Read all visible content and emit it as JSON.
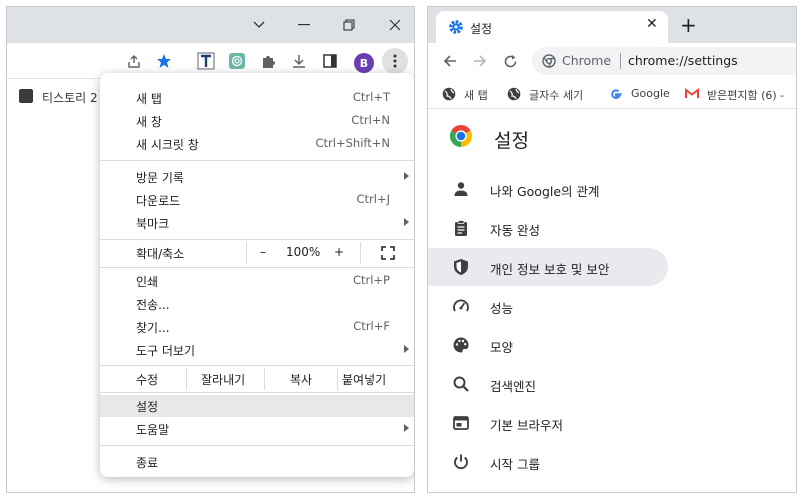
{
  "left": {
    "avatar_letter": "B",
    "bookmark_text": "티스토리 2",
    "menu": {
      "new_tab": {
        "label": "새 탭",
        "shortcut": "Ctrl+T"
      },
      "new_window": {
        "label": "새 창",
        "shortcut": "Ctrl+N"
      },
      "new_incognito": {
        "label": "새 시크릿 창",
        "shortcut": "Ctrl+Shift+N"
      },
      "history": {
        "label": "방문 기록"
      },
      "downloads": {
        "label": "다운로드",
        "shortcut": "Ctrl+J"
      },
      "bookmarks": {
        "label": "북마크"
      },
      "zoom": {
        "label": "확대/축소",
        "minus": "–",
        "value": "100%",
        "plus": "+"
      },
      "print": {
        "label": "인쇄",
        "shortcut": "Ctrl+P"
      },
      "cast": {
        "label": "전송..."
      },
      "find": {
        "label": "찾기...",
        "shortcut": "Ctrl+F"
      },
      "more_tools": {
        "label": "도구 더보기"
      },
      "edit": {
        "label": "수정",
        "cut": "잘라내기",
        "copy": "복사",
        "paste": "붙여넣기"
      },
      "settings": {
        "label": "설정"
      },
      "help": {
        "label": "도움말"
      },
      "exit": {
        "label": "종료"
      }
    }
  },
  "right": {
    "tab_title": "설정",
    "omnibox_label": "Chrome",
    "omnibox_url": "chrome://settings",
    "bookmarks": [
      {
        "label": "새 탭"
      },
      {
        "label": "글자수 세기"
      },
      {
        "label": "Google"
      },
      {
        "label": "받은편지함 (6) -"
      }
    ],
    "settings_title": "설정",
    "settings_items": [
      {
        "label": "나와 Google의 관계",
        "icon": "person-icon"
      },
      {
        "label": "자동 완성",
        "icon": "clipboard-icon"
      },
      {
        "label": "개인 정보 보호 및 보안",
        "icon": "shield-icon"
      },
      {
        "label": "성능",
        "icon": "speedometer-icon"
      },
      {
        "label": "모양",
        "icon": "palette-icon"
      },
      {
        "label": "검색엔진",
        "icon": "search-icon"
      },
      {
        "label": "기본 브라우저",
        "icon": "browser-window-icon"
      },
      {
        "label": "시작 그룹",
        "icon": "power-icon"
      }
    ]
  },
  "colors": {
    "accent_blue": "#1a73e8",
    "menu_highlight": "#e8e8e8",
    "active_row": "#e8eaed"
  }
}
